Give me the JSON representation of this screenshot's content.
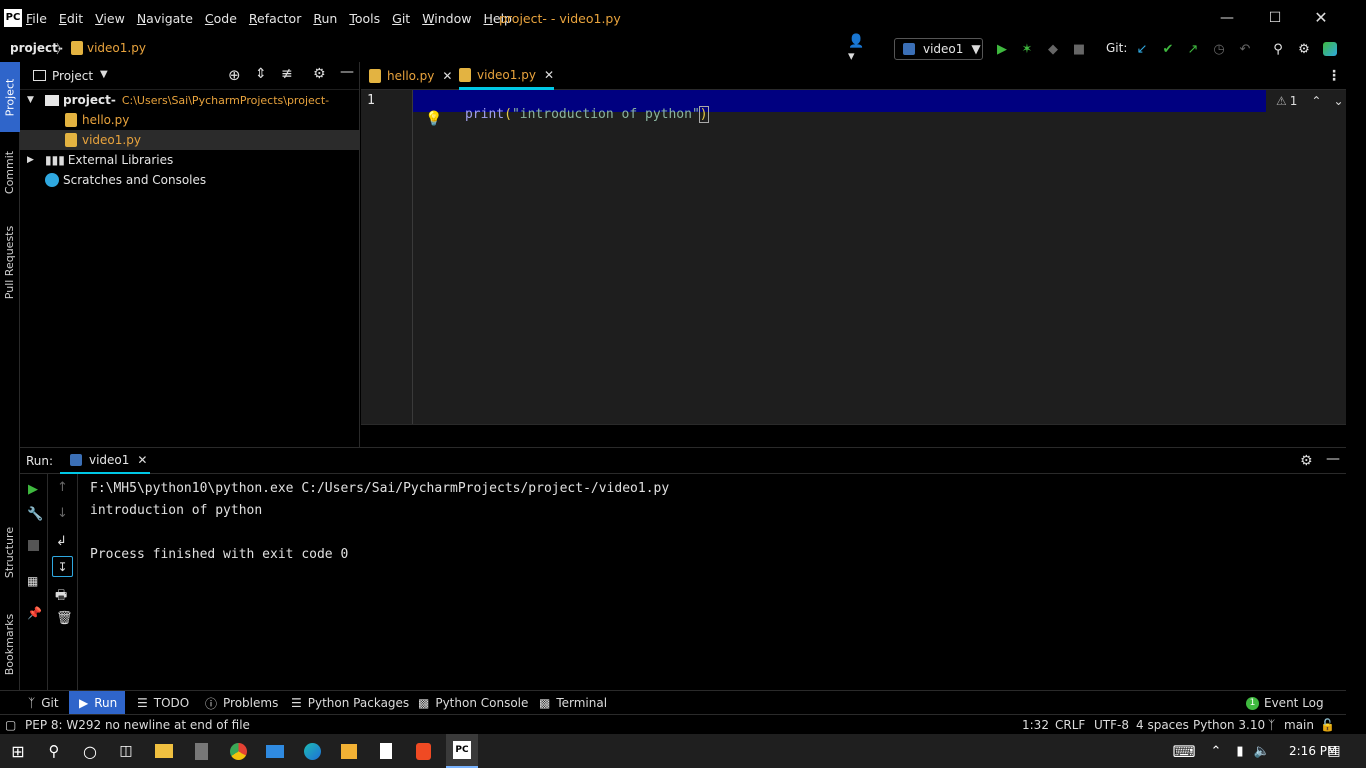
{
  "app": {
    "logo": "PC",
    "window_title": "project- - video1.py"
  },
  "menu": [
    "File",
    "Edit",
    "View",
    "Navigate",
    "Code",
    "Refactor",
    "Run",
    "Tools",
    "Git",
    "Window",
    "Help"
  ],
  "menu_underline": [
    "F",
    "E",
    "V",
    "N",
    "C",
    "R",
    "R",
    "T",
    "G",
    "W",
    "H"
  ],
  "navbar": {
    "breadcrumb_project": "project-",
    "breadcrumb_file": "video1.py",
    "run_config": "video1",
    "git_label": "Git:"
  },
  "left_stripe": {
    "project": "Project",
    "commit": "Commit",
    "pull_requests": "Pull Requests",
    "structure": "Structure",
    "bookmarks": "Bookmarks"
  },
  "project_pane": {
    "title": "Project",
    "root_name": "project-",
    "root_path": "C:\\Users\\Sai\\PycharmProjects\\project-",
    "files": [
      "hello.py",
      "video1.py"
    ],
    "external_libraries": "External Libraries",
    "scratches": "Scratches and Consoles"
  },
  "editor": {
    "tabs": [
      "hello.py",
      "video1.py"
    ],
    "line_number": "1",
    "code": {
      "func": "print",
      "open": "(",
      "string": "\"introduction of python\"",
      "close": ")"
    },
    "warning_count": "1"
  },
  "run": {
    "label": "Run:",
    "tab": "video1",
    "output": [
      "F:\\MH5\\python10\\python.exe C:/Users/Sai/PycharmProjects/project-/video1.py",
      "introduction of python",
      "",
      "Process finished with exit code 0"
    ]
  },
  "tool_windows": {
    "git": "Git",
    "run": "Run",
    "todo": "TODO",
    "problems": "Problems",
    "python_packages": "Python Packages",
    "python_console": "Python Console",
    "terminal": "Terminal",
    "event_log": "Event Log",
    "event_count": "1"
  },
  "status": {
    "message": "PEP 8: W292 no newline at end of file",
    "position": "1:32",
    "line_sep": "CRLF",
    "encoding": "UTF-8",
    "indent": "4 spaces",
    "interpreter": "Python 3.10",
    "branch": "main"
  },
  "taskbar": {
    "time": "2:16 PM"
  },
  "colors": {
    "accent_cyan": "#00c8e6",
    "code_func": "#a0a0f0",
    "code_string": "#8ab4a0",
    "selection": "#000080",
    "file_orange": "#e8a33d",
    "run_green": "#3fb93f"
  }
}
